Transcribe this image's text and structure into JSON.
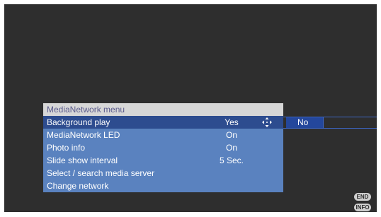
{
  "menu": {
    "title": "MediaNetwork menu",
    "items": [
      {
        "label": "Background play",
        "value": "Yes",
        "selected": true
      },
      {
        "label": "MediaNetwork LED",
        "value": "On"
      },
      {
        "label": "Photo info",
        "value": "On"
      },
      {
        "label": "Slide show interval",
        "value": "5 Sec."
      },
      {
        "label": "Select / search media server",
        "value": ""
      },
      {
        "label": "Change network",
        "value": ""
      }
    ],
    "nav_icon": "four-way-arrows-icon"
  },
  "submenu": {
    "option": "No"
  },
  "keys": {
    "end": "END",
    "info": "INFO"
  },
  "colors": {
    "screen_bg": "#2e2e2e",
    "menu_header_bg": "#d7d7d7",
    "menu_bg": "#5a82bf",
    "selected_bg": "#2d4c8f",
    "submenu_option_bg": "#24479c"
  }
}
